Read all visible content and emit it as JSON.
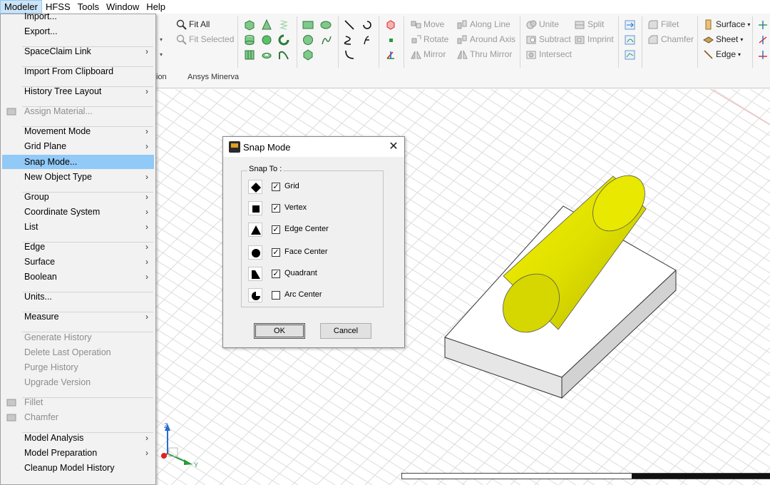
{
  "menubar": {
    "items": [
      "Modeler",
      "HFSS",
      "Tools",
      "Window",
      "Help"
    ]
  },
  "ribbon": {
    "view": {
      "fit_all": "Fit All",
      "fit_selected": "Fit Selected"
    },
    "transform": {
      "move": "Move",
      "rotate": "Rotate",
      "mirror": "Mirror"
    },
    "duplicate": {
      "along_line": "Along Line",
      "around_axis": "Around Axis",
      "thru_mirror": "Thru Mirror"
    },
    "boolean": {
      "unite": "Unite",
      "subtract": "Subtract",
      "intersect": "Intersect",
      "split": "Split",
      "imprint": "Imprint"
    },
    "edit": {
      "fillet": "Fillet",
      "chamfer": "Chamfer"
    },
    "create": {
      "surface": "Surface",
      "sheet": "Sheet",
      "edge": "Edge"
    },
    "group_labels": {
      "partial": "ion",
      "minerva": "Ansys Minerva"
    }
  },
  "dropdown": {
    "items": [
      {
        "label": "Import...",
        "submenu": false,
        "disabled": false
      },
      {
        "label": "Export...",
        "submenu": false,
        "disabled": false
      },
      {
        "label": "SpaceClaim Link",
        "submenu": true,
        "disabled": false
      },
      {
        "label": "Import From Clipboard",
        "submenu": false,
        "disabled": false
      },
      {
        "label": "History Tree Layout",
        "submenu": true,
        "disabled": false
      },
      {
        "label": "Assign Material...",
        "submenu": false,
        "disabled": true
      },
      {
        "label": "Movement Mode",
        "submenu": true,
        "disabled": false
      },
      {
        "label": "Grid Plane",
        "submenu": true,
        "disabled": false
      },
      {
        "label": "Snap Mode...",
        "submenu": false,
        "disabled": false
      },
      {
        "label": "New Object Type",
        "submenu": true,
        "disabled": false
      },
      {
        "label": "Group",
        "submenu": true,
        "disabled": false
      },
      {
        "label": "Coordinate System",
        "submenu": true,
        "disabled": false
      },
      {
        "label": "List",
        "submenu": true,
        "disabled": false
      },
      {
        "label": "Edge",
        "submenu": true,
        "disabled": false
      },
      {
        "label": "Surface",
        "submenu": true,
        "disabled": false
      },
      {
        "label": "Boolean",
        "submenu": true,
        "disabled": false
      },
      {
        "label": "Units...",
        "submenu": false,
        "disabled": false
      },
      {
        "label": "Measure",
        "submenu": true,
        "disabled": false
      },
      {
        "label": "Generate History",
        "submenu": false,
        "disabled": true
      },
      {
        "label": "Delete Last Operation",
        "submenu": false,
        "disabled": true
      },
      {
        "label": "Purge History",
        "submenu": false,
        "disabled": true
      },
      {
        "label": "Upgrade Version",
        "submenu": false,
        "disabled": true
      },
      {
        "label": "Fillet",
        "submenu": false,
        "disabled": true
      },
      {
        "label": "Chamfer",
        "submenu": false,
        "disabled": true
      },
      {
        "label": "Model Analysis",
        "submenu": true,
        "disabled": false
      },
      {
        "label": "Model Preparation",
        "submenu": true,
        "disabled": false
      },
      {
        "label": "Cleanup Model History",
        "submenu": false,
        "disabled": false
      }
    ],
    "highlighted": "Snap Mode...",
    "submenu_arrow": "›"
  },
  "dialog": {
    "title": "Snap Mode",
    "close_glyph": "✕",
    "group_label": "Snap To :",
    "options": [
      {
        "label": "Grid",
        "checked": true,
        "icon": "diamond-icon"
      },
      {
        "label": "Vertex",
        "checked": true,
        "icon": "square-icon"
      },
      {
        "label": "Edge Center",
        "checked": true,
        "icon": "triangle-icon"
      },
      {
        "label": "Face Center",
        "checked": true,
        "icon": "circle-icon"
      },
      {
        "label": "Quadrant",
        "checked": true,
        "icon": "quadrant-icon"
      },
      {
        "label": "Arc Center",
        "checked": false,
        "icon": "arc-center-icon"
      }
    ],
    "check_glyph": "✓",
    "ok_label": "OK",
    "cancel_label": "Cancel"
  },
  "triad": {
    "z": "Z",
    "y": "Y"
  },
  "colors": {
    "cylinder": "#e6e600",
    "cylinder_dark": "#b8b800",
    "box": "#f4f4f4",
    "grid": "#d9d9d9",
    "menu_highlight": "#91c9f7"
  }
}
